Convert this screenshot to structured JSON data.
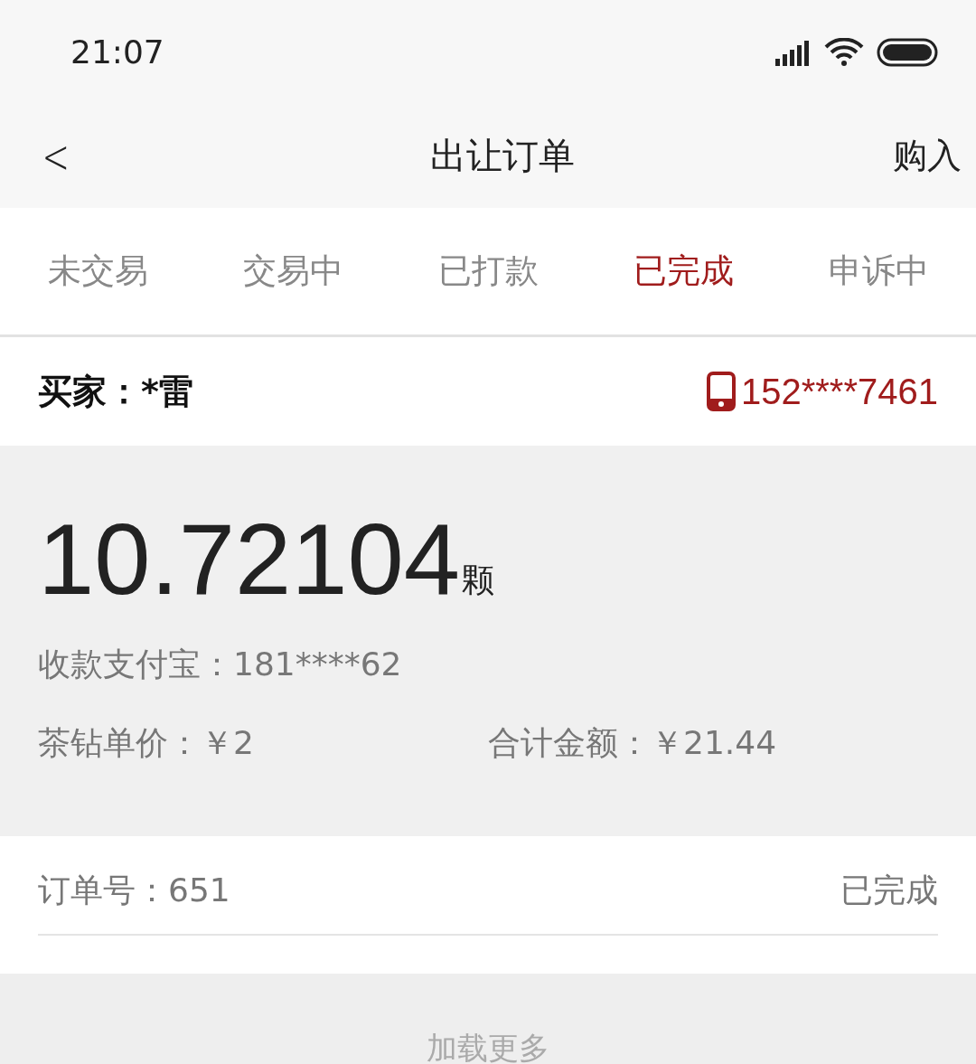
{
  "status_bar": {
    "time": "21:07"
  },
  "nav": {
    "title": "出让订单",
    "back": "<",
    "action": "购入"
  },
  "tabs": [
    {
      "label": "未交易",
      "selected": false
    },
    {
      "label": "交易中",
      "selected": false
    },
    {
      "label": "已打款",
      "selected": false
    },
    {
      "label": "已完成",
      "selected": true
    },
    {
      "label": "申诉中",
      "selected": false
    }
  ],
  "order": {
    "buyer": "买家：*雷",
    "phone": "152****7461",
    "amount": "10.72104",
    "unit": "颗",
    "alipay": "收款支付宝：181****62",
    "unit_price": "茶钻单价：￥2",
    "total": "合计金额：￥21.44",
    "order_no": "订单号：651",
    "status": "已完成"
  },
  "load_more": "加载更多"
}
